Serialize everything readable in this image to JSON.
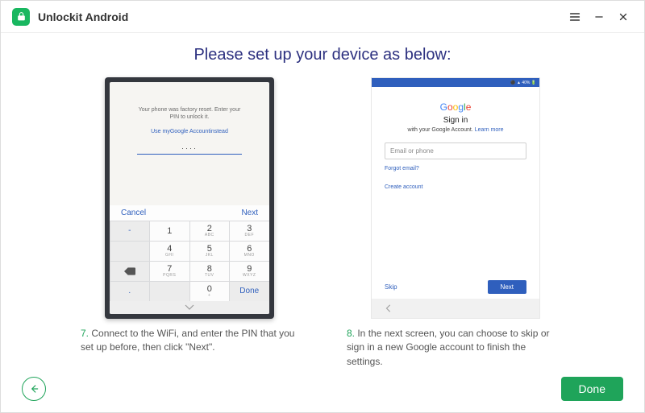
{
  "app": {
    "title": "Unlockit Android"
  },
  "heading": "Please set up your device as below:",
  "phone1": {
    "msg_line1": "Your phone was factory reset. Enter your",
    "msg_line2": "PIN to unlock it.",
    "alt_link": "Use myGoogle Accountinstead",
    "dots": "····",
    "cancel": "Cancel",
    "next": "Next",
    "keys": {
      "k1": "1",
      "k2": "2",
      "k2s": "ABC",
      "k3": "3",
      "k3s": "DEF",
      "k4": "4",
      "k4s": "GHI",
      "k5": "5",
      "k5s": "JKL",
      "k6": "6",
      "k6s": "MNO",
      "k7": "7",
      "k7s": "PQRS",
      "k8": "8",
      "k8s": "TUV",
      "k9": "9",
      "k9s": "WXYZ",
      "k0": "0",
      "k0s": "+",
      "kminus": "-",
      "kdot": ".",
      "done": "Done"
    }
  },
  "phone2": {
    "status_right": "⚫ ▲ 40% 🔋",
    "google": "Google",
    "signin": "Sign in",
    "sub_pre": "with your Google Account. ",
    "sub_link": "Learn more",
    "email_placeholder": "Email or phone",
    "forgot": "Forgot email?",
    "create": "Create account",
    "skip": "Skip",
    "next": "Next"
  },
  "caption7": {
    "num": "7.",
    "text": " Connect to the WiFi, and enter the PIN that you set up before, then click \"Next\"."
  },
  "caption8": {
    "num": "8.",
    "text": " In the next screen, you can choose to skip or sign in a new Google account to finish the settings."
  },
  "buttons": {
    "done": "Done"
  }
}
